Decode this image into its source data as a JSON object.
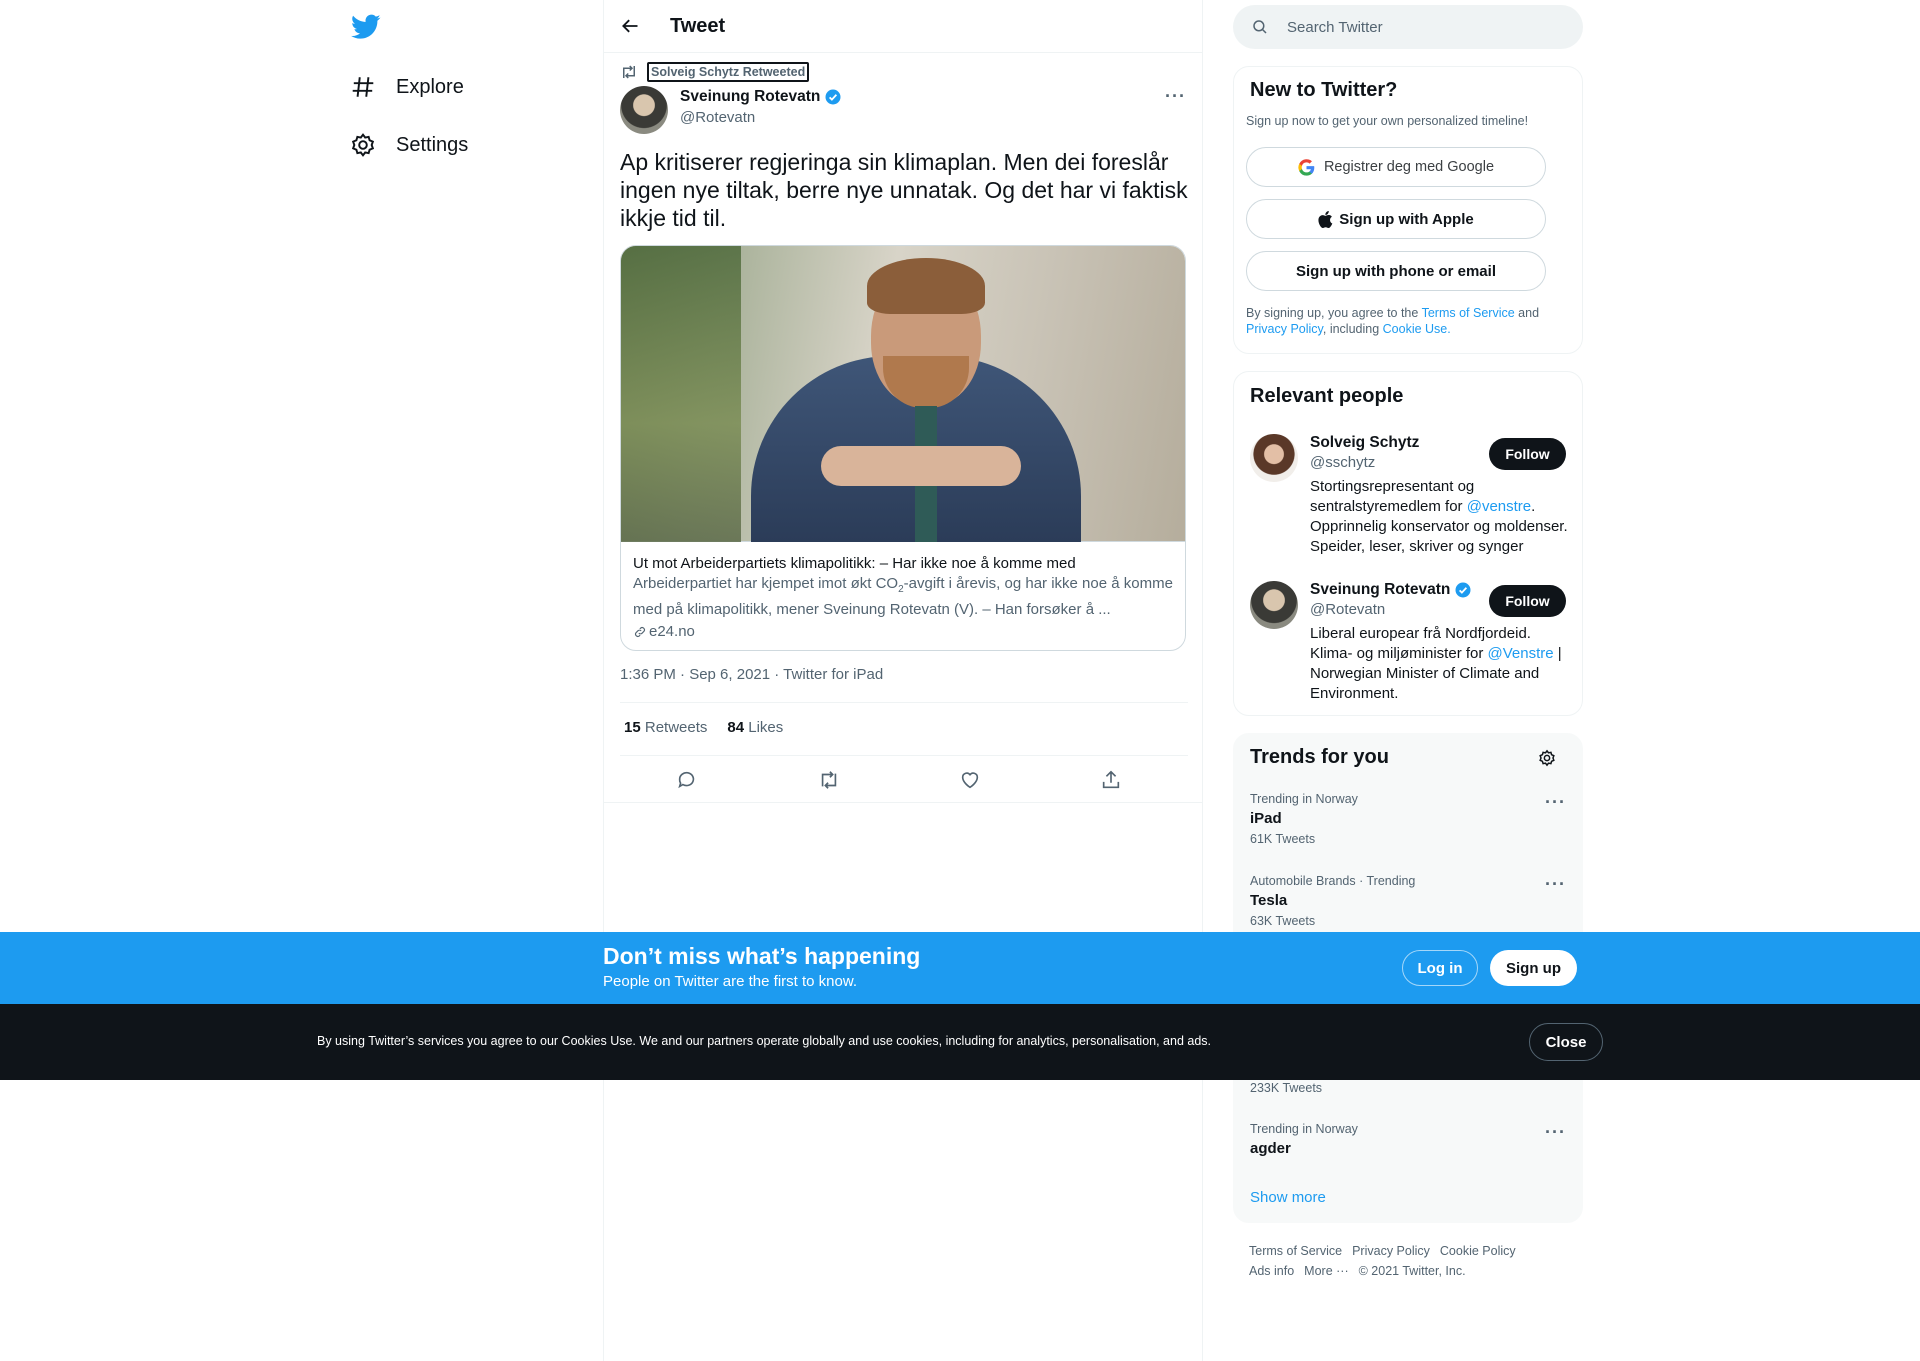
{
  "nav": {
    "explore": "Explore",
    "settings": "Settings"
  },
  "header": {
    "title": "Tweet"
  },
  "tweet": {
    "retweeted_by": "Solveig Schytz Retweeted",
    "author_name": "Sveinung Rotevatn",
    "author_handle": "@Rotevatn",
    "text": "Ap kritiserer regjeringa sin klimaplan. Men dei foreslår ingen nye tiltak, berre nye unnatak. Og det har vi faktisk ikkje tid til.",
    "card": {
      "title": "Ut mot Arbeiderpartiets klimapolitikk: – Har ikke noe å komme med",
      "desc_1": "Arbeiderpartiet har kjempet imot økt CO",
      "desc_sub": "2",
      "desc_2": "-avgift i årevis, og har ikke noe å komme med på klimapolitikk, mener Sveinung Rotevatn (V). – Han forsøker å ...",
      "domain": "e24.no"
    },
    "meta": "1:36 PM · Sep 6, 2021 · Twitter for iPad",
    "retweets_count": "15",
    "retweets_label": "Retweets",
    "likes_count": "84",
    "likes_label": "Likes"
  },
  "search": {
    "placeholder": "Search Twitter"
  },
  "signup": {
    "title": "New to Twitter?",
    "subtitle": "Sign up now to get your own personalized timeline!",
    "google": "Registrer deg med Google",
    "apple": "Sign up with Apple",
    "phone": "Sign up with phone or email",
    "legal_1": "By signing up, you agree to the ",
    "legal_tos": "Terms of Service",
    "legal_2": " and ",
    "legal_pp": "Privacy Policy",
    "legal_3": ", including ",
    "legal_cookie": "Cookie Use."
  },
  "relevant": {
    "title": "Relevant people",
    "follow": "Follow",
    "people": [
      {
        "name": "Solveig Schytz",
        "handle": "@sschytz",
        "bio_1": "Stortingsrepresentant og sentralstyremedlem for ",
        "bio_link": "@venstre",
        "bio_2": ". Opprinnelig konservator og moldenser. Speider, leser, skriver og synger"
      },
      {
        "name": "Sveinung Rotevatn",
        "handle": "@Rotevatn",
        "bio_1": "Liberal europear frå Nordfjordeid. Klima- og miljøminister for ",
        "bio_link": "@Venstre",
        "bio_2": " | Norwegian Minister of Climate and Environment."
      }
    ]
  },
  "trends": {
    "title": "Trends for you",
    "items": [
      {
        "context": "Trending in Norway",
        "name": "iPad",
        "count": "61K Tweets"
      },
      {
        "context": "Automobile Brands · Trending",
        "name": "Tesla",
        "count": "63K Tweets"
      },
      {
        "count": "233K Tweets"
      },
      {
        "context": "Trending in Norway",
        "name": "agder"
      }
    ],
    "show_more": "Show more"
  },
  "footer": {
    "tos": "Terms of Service",
    "privacy": "Privacy Policy",
    "cookie": "Cookie Policy",
    "ads": "Ads info",
    "more": "More ···",
    "copyright": "© 2021 Twitter, Inc."
  },
  "banner": {
    "title": "Don’t miss what’s happening",
    "subtitle": "People on Twitter are the first to know.",
    "login": "Log in",
    "signup": "Sign up"
  },
  "cookie": {
    "text": "By using Twitter’s services you agree to our Cookies Use. We and our partners operate globally and use cookies, including for analytics, personalisation, and ads.",
    "close": "Close"
  },
  "colors": {
    "brand": "#1d9bf0",
    "text": "#0f1419",
    "secondary": "#536471",
    "cookie_bar": "#0f1419"
  }
}
